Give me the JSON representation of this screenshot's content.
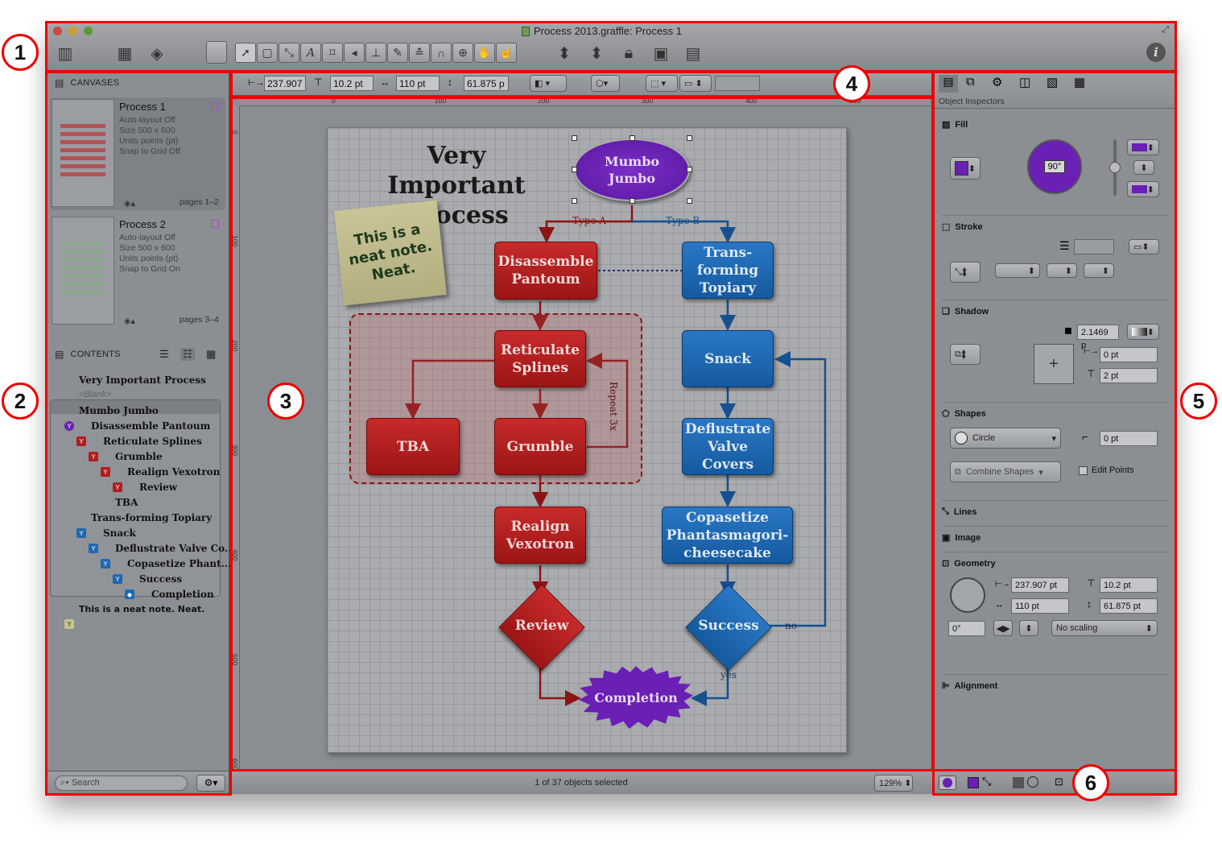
{
  "window": {
    "title": "Process 2013.graffle: Process 1"
  },
  "callouts": [
    "1",
    "2",
    "3",
    "4",
    "5",
    "6"
  ],
  "canvases": {
    "header": "CANVASES",
    "items": [
      {
        "name": "Process 1",
        "autolayout": "Auto-layout Off",
        "size": "Size 500 x 600",
        "units": "Units points (pt)",
        "snap": "Snap to Grid Off",
        "pages": "pages 1–2"
      },
      {
        "name": "Process 2",
        "autolayout": "Auto-layout Off",
        "size": "Size 500 x 600",
        "units": "Units points (pt)",
        "snap": "Snap to Grid On",
        "pages": "pages 3–4"
      }
    ]
  },
  "contents": {
    "header": "CONTENTS",
    "items": [
      "Very Important Process",
      "<Blank>",
      "Mumbo Jumbo",
      "Disassemble Pantoum",
      "Reticulate Splines",
      "Grumble",
      "Realign Vexotron",
      "Review",
      "TBA",
      "Trans-forming Topiary",
      "Snack",
      "Deflustrate Valve Co...",
      "Copasetize Phant...",
      "Success",
      "Completion",
      "This is a neat note. Neat."
    ],
    "search_placeholder": "Search"
  },
  "inspector_bar": {
    "x": "237.907",
    "y": "10.2 pt",
    "w": "110 pt",
    "h": "61.875 p"
  },
  "rulers": {
    "h": [
      "0",
      "100",
      "200",
      "300",
      "400",
      "500"
    ],
    "v": [
      "0",
      "100",
      "200",
      "300",
      "400",
      "500",
      "600"
    ]
  },
  "diagram": {
    "title": "Very Important Process",
    "note": "This is a neat note. Neat.",
    "start": "Mumbo Jumbo",
    "type_a": "Type A",
    "type_b": "Type B",
    "disassemble": "Disassemble Pantoum",
    "reticulate": "Reticulate Splines",
    "tba": "TBA",
    "grumble": "Grumble",
    "repeat": "Repeat 3x",
    "realign": "Realign Vexotron",
    "review": "Review",
    "transforming": "Trans- forming Topiary",
    "snack": "Snack",
    "deflustrate": "Deflustrate Valve Covers",
    "copasetize": "Copasetize Phantasmagori- cheesecake",
    "success": "Success",
    "no": "no",
    "yes": "yes",
    "completion": "Completion"
  },
  "status": {
    "selection": "1 of 37 objects selected",
    "zoom": "129%"
  },
  "inspectors": {
    "label": "Object Inspectors",
    "fill": "Fill",
    "fill_color": "#6a1fb5",
    "fill_angle": "90°",
    "stroke": "Stroke",
    "shadow": "Shadow",
    "shadow_value": "2.1469 p",
    "shadow_x": "0 pt",
    "shadow_y": "2 pt",
    "shapes": "Shapes",
    "shape_name": "Circle",
    "corner": "0 pt",
    "combine": "Combine Shapes",
    "edit_points": "Edit Points",
    "lines": "Lines",
    "image": "Image",
    "geometry": "Geometry",
    "geo_x": "237.907 pt",
    "geo_y": "10.2 pt",
    "geo_w": "110 pt",
    "geo_h": "61.875 pt",
    "rotation": "0°",
    "scaling": "No scaling",
    "alignment": "Alignment"
  },
  "colors": {
    "accent_red": "#b21d1d",
    "accent_blue": "#1f68b1",
    "purple": "#6a1fb5",
    "callout_red": "#ee0000"
  }
}
